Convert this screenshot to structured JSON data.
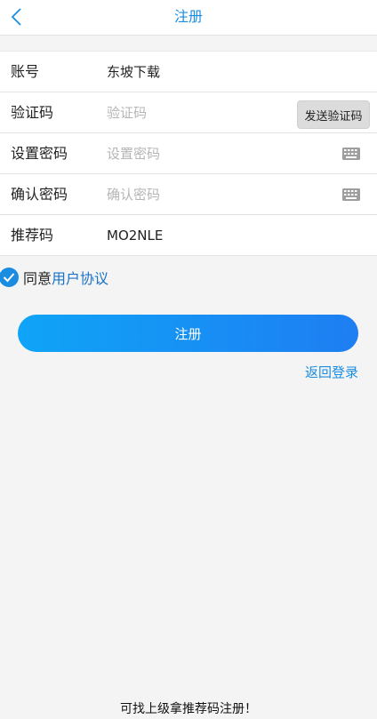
{
  "header": {
    "title": "注册",
    "back_icon": "chevron-left-icon"
  },
  "form": {
    "account": {
      "label": "账号",
      "value": "东坡下载"
    },
    "code": {
      "label": "验证码",
      "placeholder": "验证码",
      "send_label": "发送验证码"
    },
    "password": {
      "label": "设置密码",
      "placeholder": "设置密码"
    },
    "confirm": {
      "label": "确认密码",
      "placeholder": "确认密码"
    },
    "referral": {
      "label": "推荐码",
      "value": "MO2NLE"
    }
  },
  "agreement": {
    "checked": true,
    "prefix": "同意",
    "link": "用户协议"
  },
  "actions": {
    "register_label": "注册",
    "back_login_label": "返回登录"
  },
  "footer": {
    "note": "可找上级拿推荐码注册！"
  },
  "colors": {
    "accent": "#1a8de0",
    "button_start": "#0fa4f7",
    "button_end": "#1e7ef2",
    "background": "#f4f4f4"
  }
}
